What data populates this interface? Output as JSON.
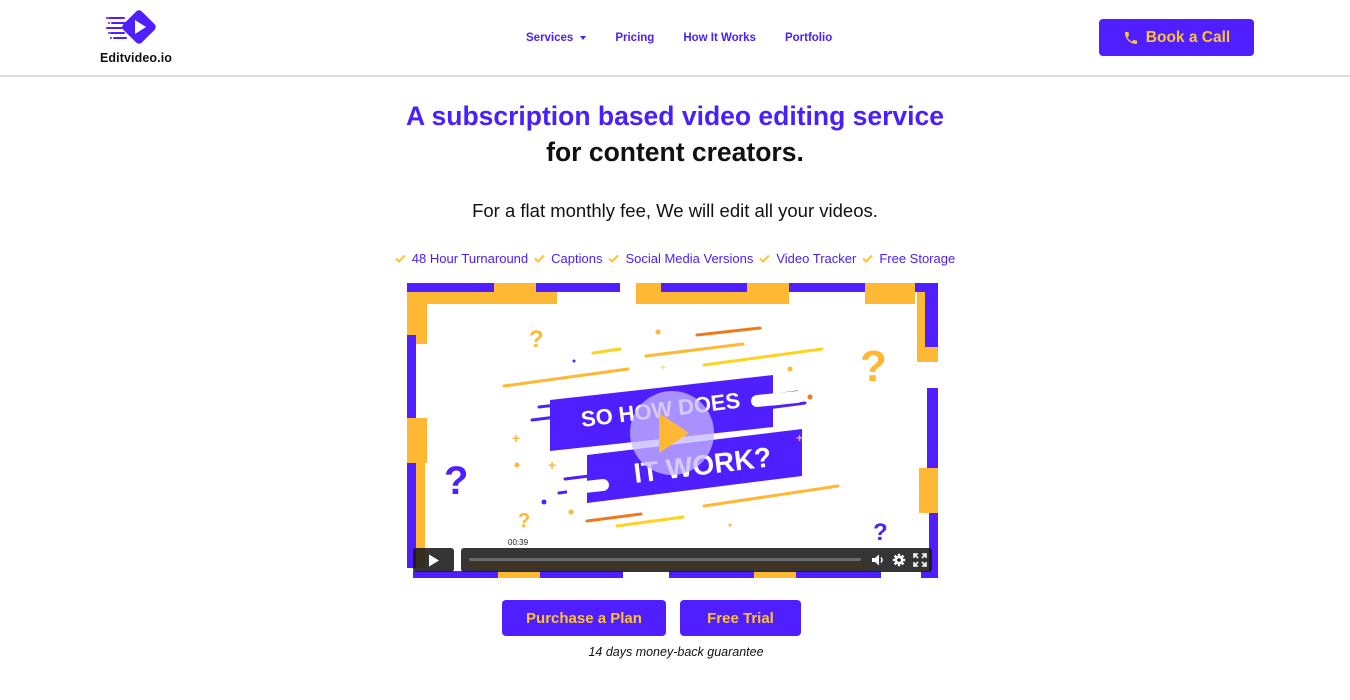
{
  "brand": {
    "name": "Editvideo.io",
    "logo_icon": "play-motion-icon",
    "primary_color": "#4f1fff",
    "accent_color": "#ffc233"
  },
  "nav": {
    "items": [
      {
        "label": "Services",
        "has_dropdown": true
      },
      {
        "label": "Pricing",
        "has_dropdown": false
      },
      {
        "label": "How It Works",
        "has_dropdown": false
      },
      {
        "label": "Portfolio",
        "has_dropdown": false
      }
    ]
  },
  "header": {
    "cta_label": "Book a Call",
    "cta_icon": "phone-icon"
  },
  "hero": {
    "title_line1": "A subscription based video editing service",
    "title_line2": "for content creators.",
    "subtitle": "For a flat monthly fee, We will edit all your videos.",
    "features": [
      "48 Hour Turnaround",
      "Captions",
      "Social Media Versions",
      "Video Tracker",
      "Free Storage"
    ]
  },
  "video": {
    "thumbnail_line1": "SO HOW DOES",
    "thumbnail_line2": "IT WORK?",
    "time_tooltip": "00:39",
    "progress": 0,
    "controls": [
      "play-icon",
      "volume-icon",
      "settings-icon",
      "fullscreen-icon"
    ]
  },
  "actions": {
    "purchase_label": "Purchase a Plan",
    "trial_label": "Free Trial",
    "guarantee_text": "14 days money-back guarantee"
  }
}
